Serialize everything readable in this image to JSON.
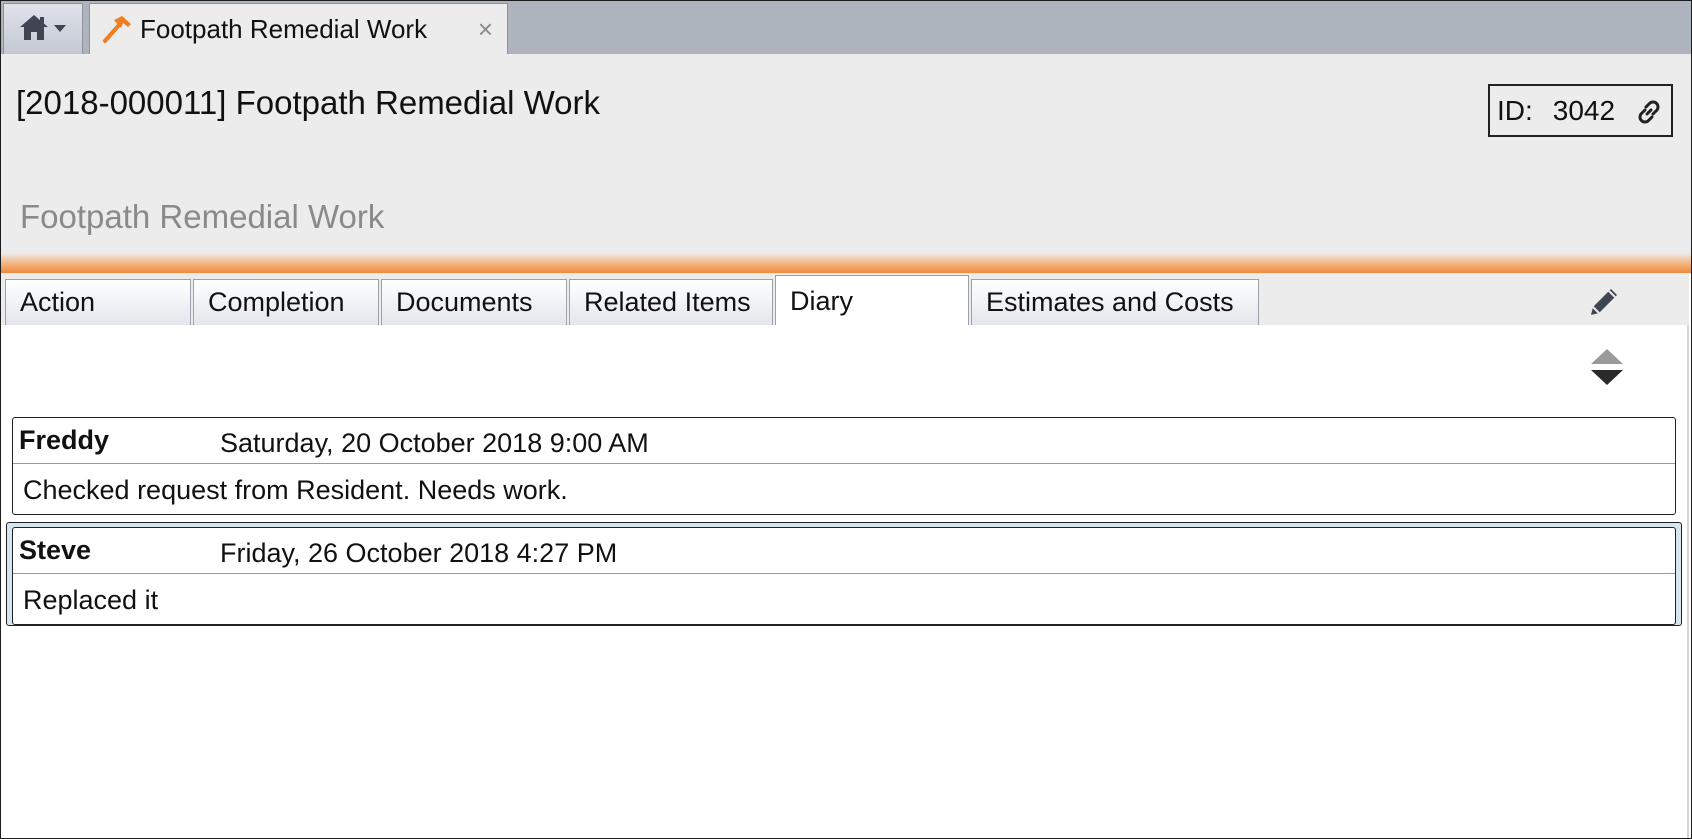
{
  "tabbar": {
    "home_icon": "home-icon",
    "dropdown_icon": "caret-down-icon",
    "open_tab": {
      "icon": "hammer-icon",
      "label": "Footpath Remedial Work",
      "close_glyph": "×"
    }
  },
  "header": {
    "title": "[2018-000011] Footpath Remedial Work",
    "subtitle": "Footpath Remedial Work",
    "id_label": "ID:",
    "id_value": "3042",
    "link_icon": "link-icon",
    "accent_color": "#ef8a3c"
  },
  "tabs": [
    {
      "label": "Action",
      "active": false
    },
    {
      "label": "Completion",
      "active": false
    },
    {
      "label": "Documents",
      "active": false
    },
    {
      "label": "Related Items",
      "active": false
    },
    {
      "label": "Diary",
      "active": true
    },
    {
      "label": "Estimates and Costs",
      "active": false
    }
  ],
  "toolbar": {
    "edit_icon": "pencil-icon",
    "sort_icon": "sort-icon"
  },
  "diary": {
    "entries": [
      {
        "author": "Freddy",
        "datetime": "Saturday, 20 October 2018 9:00 AM",
        "text": "Checked request from Resident. Needs work.",
        "selected": false
      },
      {
        "author": "Steve",
        "datetime": "Friday, 26 October 2018 4:27 PM",
        "text": "Replaced it",
        "selected": true
      }
    ]
  }
}
